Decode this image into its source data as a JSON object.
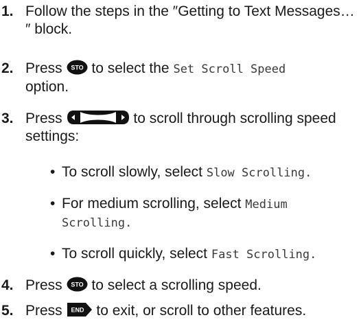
{
  "steps": [
    {
      "num": "1.",
      "text": "Follow the steps in the ″Getting to Text Messages…″ block."
    },
    {
      "num": "2.",
      "pre": "Press",
      "key": "STO",
      "mid": "to select the",
      "lcd": "Set Scroll Speed",
      "post": "option."
    },
    {
      "num": "3.",
      "pre": "Press",
      "mid": "to scroll through scrolling speed settings:"
    },
    {
      "num": "4.",
      "pre": "Press",
      "key": "STO",
      "post": "to select a scrolling speed."
    },
    {
      "num": "5.",
      "pre": "Press",
      "key": "END",
      "post": "to exit, or scroll to other features."
    }
  ],
  "bullets": [
    {
      "text": "To scroll slowly, select",
      "lcd": "Slow Scrolling."
    },
    {
      "text": "For medium scrolling, select",
      "lcd1": "Medium",
      "lcd2": "Scrolling."
    },
    {
      "text": "To scroll quickly, select",
      "lcd": "Fast Scrolling."
    }
  ],
  "bullet_char": "•",
  "colors": {
    "text": "#1a1a1a",
    "key_fill": "#111111",
    "key_text": "#ffffff",
    "lcd_text": "#3a3a3a"
  },
  "icons": {
    "sto": "sto-key-icon",
    "scroll": "scroll-keys-icon",
    "end": "end-key-icon"
  }
}
